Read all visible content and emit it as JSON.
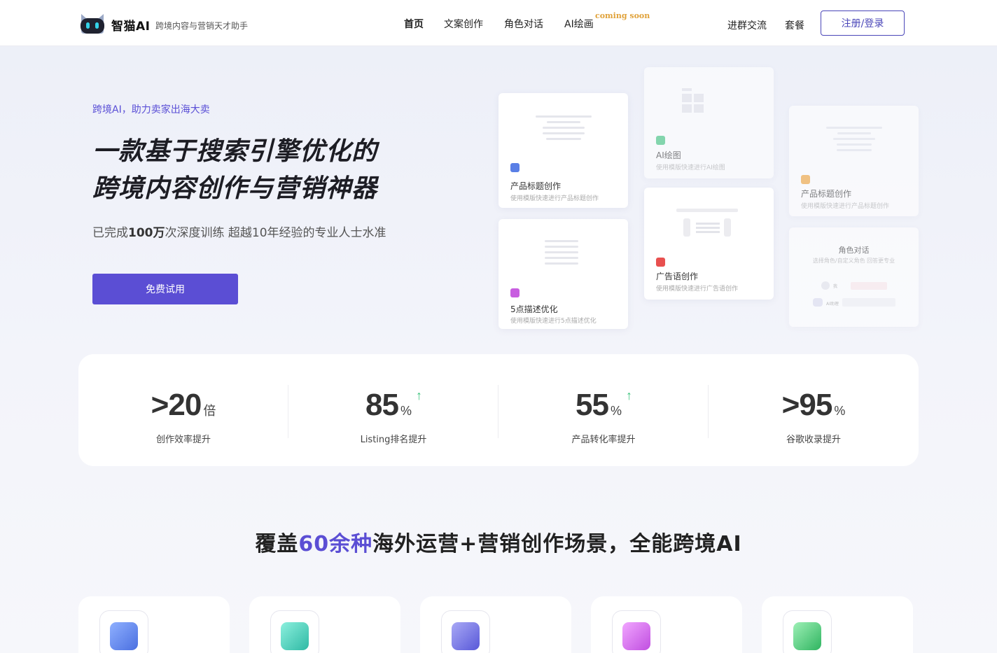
{
  "header": {
    "brand": "智猫AI",
    "slogan": "跨境内容与营销天才助手",
    "nav": [
      "首页",
      "文案创作",
      "角色对话",
      "AI绘画"
    ],
    "coming_soon": "coming soon",
    "right_links": [
      "进群交流",
      "套餐"
    ],
    "login_label": "注册/登录"
  },
  "hero": {
    "kicker": "跨境AI，助力卖家出海大卖",
    "headline_line1": "一款基于搜索引擎优化的",
    "headline_line2": "跨境内容创作与营销神器",
    "sub_prefix": "已完成",
    "sub_bold": "100万",
    "sub_suffix": "次深度训练 超越10年经验的专业人士水准",
    "cta_label": "免费试用"
  },
  "feature_cards": [
    {
      "title": "产品标题创作",
      "desc": "使用模版快速进行产品标题创作",
      "color": "#5a7fe6"
    },
    {
      "title": "5点描述优化",
      "desc": "使用模版快速进行5点描述优化",
      "color": "#c85ee0"
    },
    {
      "title": "AI绘图",
      "desc": "使用模版快速进行AI绘图",
      "color": "#3cc47c"
    },
    {
      "title": "广告语创作",
      "desc": "使用模版快速进行广告语创作",
      "color": "#e8504f"
    },
    {
      "title": "产品标题创作",
      "desc": "使用模版快速进行产品标题创作",
      "color": "#f0a234"
    },
    {
      "title": "角色对话",
      "desc": "选择角色/自定义角色 回答更专业",
      "me": "我",
      "ai": "AI助理"
    }
  ],
  "stats": [
    {
      "prefix": ">",
      "value": "20",
      "unit": "倍",
      "arrow": "",
      "label": "创作效率提升"
    },
    {
      "prefix": "",
      "value": "85",
      "unit": "%",
      "arrow": "↑",
      "label": "Listing排名提升"
    },
    {
      "prefix": "",
      "value": "55",
      "unit": "%",
      "arrow": "↑",
      "label": "产品转化率提升"
    },
    {
      "prefix": ">",
      "value": "95",
      "unit": "%",
      "arrow": "",
      "label": "谷歌收录提升"
    }
  ],
  "section": {
    "title_prefix": "覆盖",
    "title_highlight": "60余种",
    "title_suffix": "海外运营+营销创作场景，全能跨境AI"
  },
  "bottom_cards": [
    {
      "icon": "edit-icon",
      "color": "#5a7fe6"
    },
    {
      "icon": "rocket-icon",
      "color": "#3cc8b4"
    },
    {
      "icon": "document-icon",
      "color": "#6c6ce0"
    },
    {
      "icon": "bag-icon",
      "color": "#c85ee0"
    },
    {
      "icon": "clipboard-icon",
      "color": "#3cc47c"
    }
  ]
}
